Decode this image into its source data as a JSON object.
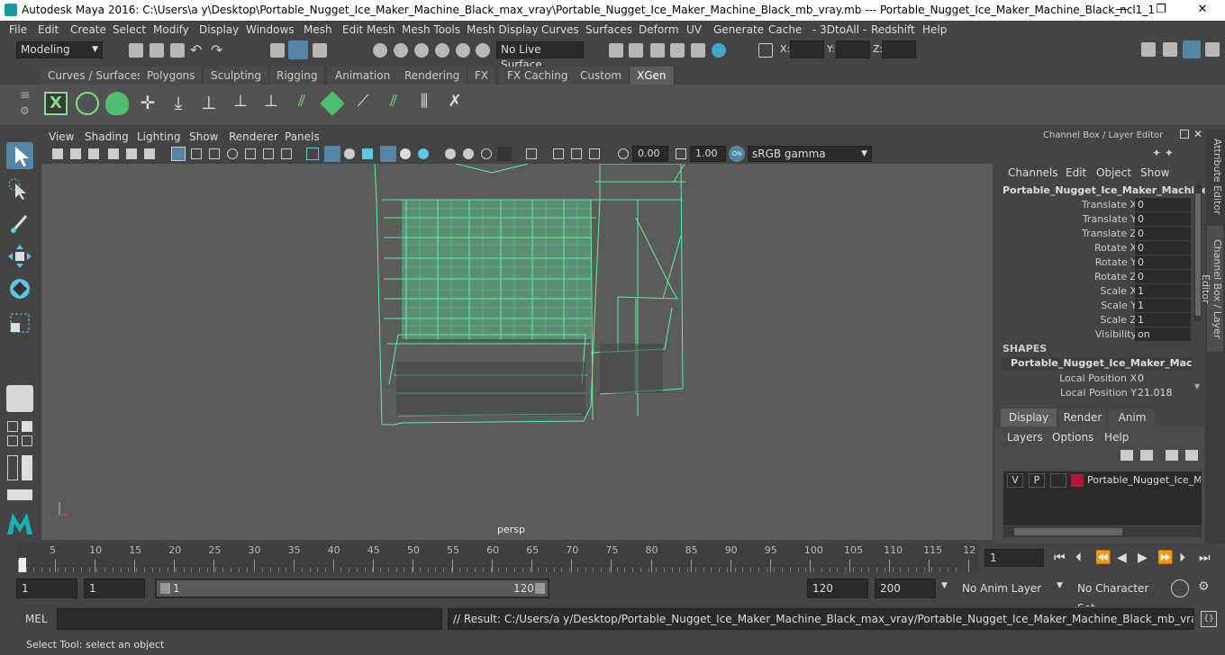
{
  "window": {
    "title": "Autodesk Maya 2016: C:\\Users\\a y\\Desktop\\Portable_Nugget_Ice_Maker_Machine_Black_max_vray\\Portable_Nugget_Ice_Maker_Machine_Black_mb_vray.mb  ---  Portable_Nugget_Ice_Maker_Machine_Black_ncl1_1",
    "min": "—",
    "max": "❐",
    "close": "✕"
  },
  "menubar": [
    "File",
    "Edit",
    "Create",
    "Select",
    "Modify",
    "Display",
    "Windows",
    "Mesh",
    "Edit Mesh",
    "Mesh Tools",
    "Mesh Display",
    "Curves",
    "Surfaces",
    "Deform",
    "UV",
    "Generate",
    "Cache",
    "- 3DtoAll -",
    "Redshift",
    "Help"
  ],
  "statusline": {
    "mode": "Modeling",
    "live_surface": "No Live Surface",
    "x_label": "X:",
    "y_label": "Y:",
    "z_label": "Z:"
  },
  "shelf_tabs": [
    "Curves / Surfaces",
    "Polygons",
    "Sculpting",
    "Rigging",
    "Animation",
    "Rendering",
    "FX",
    "FX Caching",
    "Custom",
    "XGen"
  ],
  "active_shelf_tab": "XGen",
  "viewport": {
    "menu": [
      "View",
      "Shading",
      "Lighting",
      "Show",
      "Renderer",
      "Panels"
    ],
    "exposure": "0.00",
    "gamma": "1.00",
    "color_space": "sRGB gamma",
    "camera": "persp"
  },
  "channel_box": {
    "header": "Channel Box / Layer Editor",
    "menu": [
      "Channels",
      "Edit",
      "Object",
      "Show"
    ],
    "object": "Portable_Nugget_Ice_Maker_Machine...",
    "channels": [
      {
        "label": "Translate X",
        "value": "0"
      },
      {
        "label": "Translate Y",
        "value": "0"
      },
      {
        "label": "Translate Z",
        "value": "0"
      },
      {
        "label": "Rotate X",
        "value": "0"
      },
      {
        "label": "Rotate Y",
        "value": "0"
      },
      {
        "label": "Rotate Z",
        "value": "0"
      },
      {
        "label": "Scale X",
        "value": "1"
      },
      {
        "label": "Scale Y",
        "value": "1"
      },
      {
        "label": "Scale Z",
        "value": "1"
      },
      {
        "label": "Visibility",
        "value": "on"
      }
    ],
    "shapes_header": "SHAPES",
    "shape_name": "Portable_Nugget_Ice_Maker_Machi...",
    "shape_channels": [
      {
        "label": "Local Position X",
        "value": "0"
      },
      {
        "label": "Local Position Y",
        "value": "21.018"
      }
    ]
  },
  "layer_editor": {
    "tabs": [
      "Display",
      "Render",
      "Anim"
    ],
    "menu": [
      "Layers",
      "Options",
      "Help"
    ],
    "layer": {
      "v": "V",
      "p": "P",
      "name": "Portable_Nugget_Ice_Ma",
      "color": "#b0163a"
    }
  },
  "side_tabs": [
    "Attribute Editor",
    "Channel Box / Layer Editor"
  ],
  "timeline": {
    "ticks": [
      "1",
      "5",
      "10",
      "15",
      "20",
      "25",
      "30",
      "35",
      "40",
      "45",
      "50",
      "55",
      "60",
      "65",
      "70",
      "75",
      "80",
      "85",
      "90",
      "95",
      "100",
      "105",
      "110",
      "115",
      "12"
    ],
    "current_frame": "1"
  },
  "range": {
    "start": "1",
    "playback_start": "1",
    "slider_start": "1",
    "slider_end": "120",
    "playback_end": "120",
    "end": "200",
    "anim_layer": "No Anim Layer",
    "character_set": "No Character Set"
  },
  "cmdline": {
    "label": "MEL",
    "result": "// Result: C:/Users/a y/Desktop/Portable_Nugget_Ice_Maker_Machine_Black_max_vray/Portable_Nugget_Ice_Maker_Machine_Black_mb_vray.mb"
  },
  "helpline": "Select Tool: select an object",
  "colors": {
    "wire": "#5df0a0",
    "accent": "#5285a6",
    "layer_red": "#b0163a"
  }
}
